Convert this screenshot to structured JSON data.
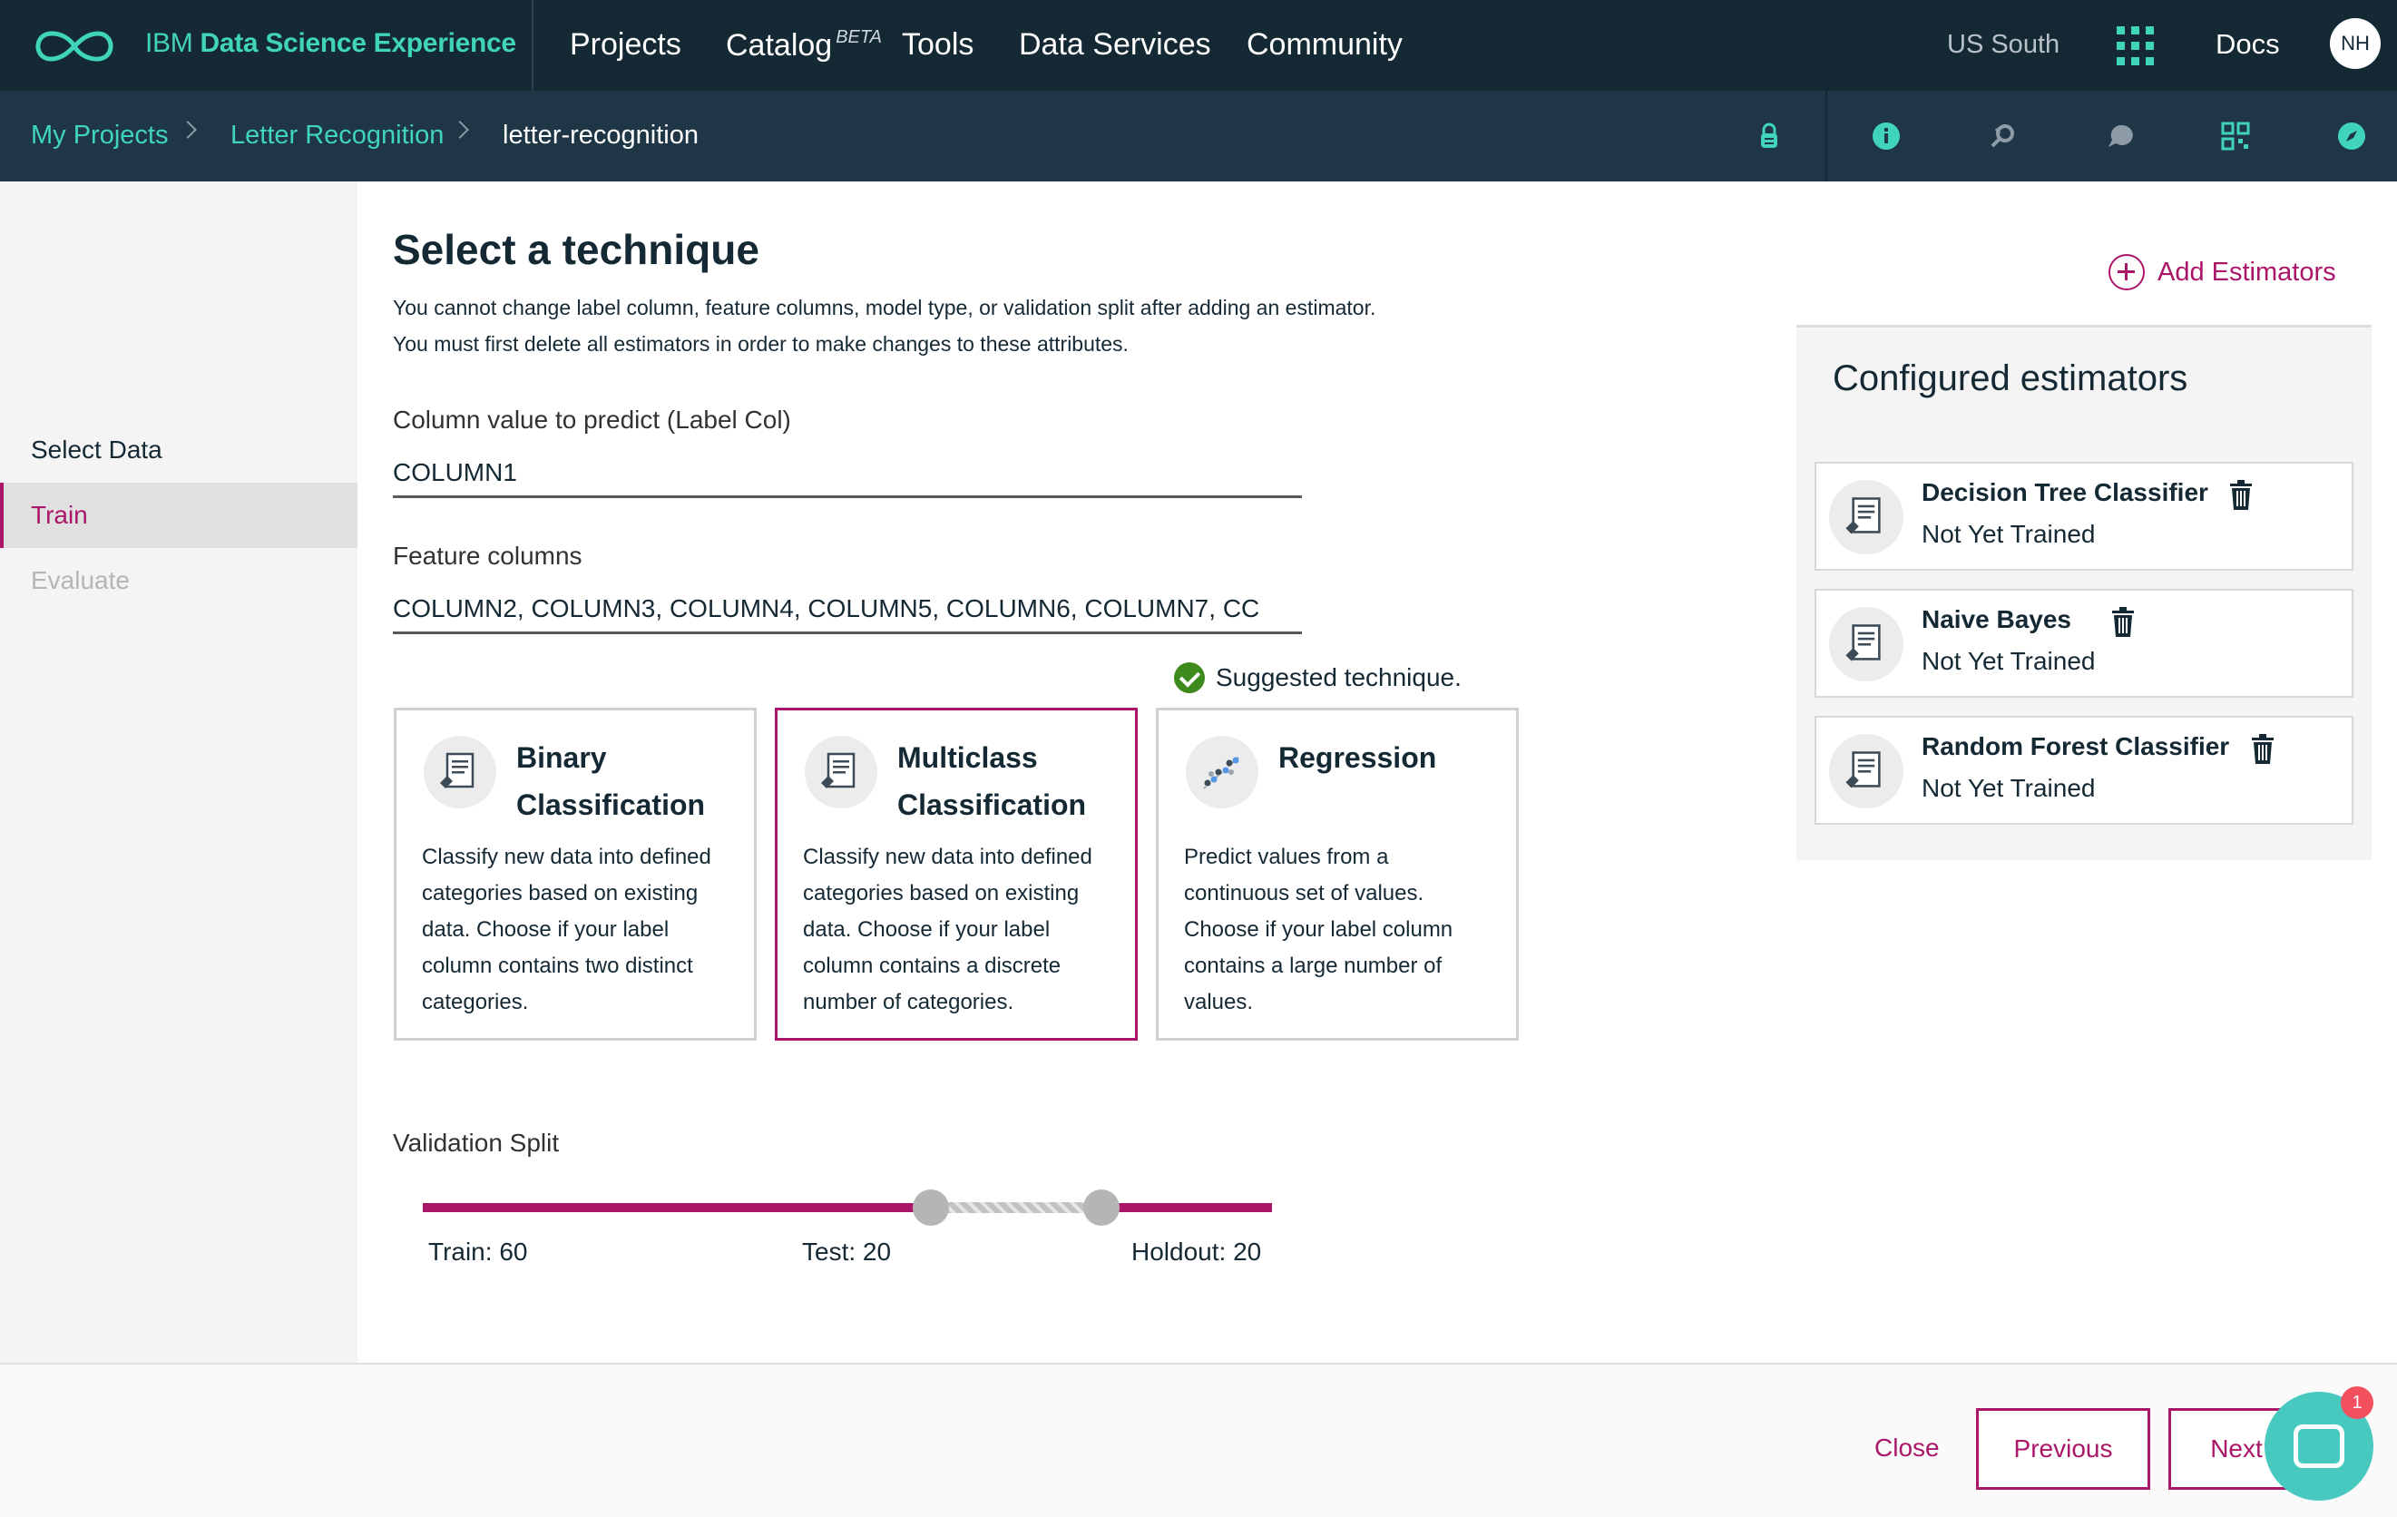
{
  "colors": {
    "topbar": "#152935",
    "subbar": "#1f3646",
    "accent_teal": "#40d5bb",
    "accent_magenta": "#aa1769",
    "chat": "#48c9c0",
    "badge": "#f34f5e",
    "check": "#3e8a1c"
  },
  "header": {
    "brand_prefix": "IBM",
    "brand_name": "Data Science Experience",
    "nav": [
      "Projects",
      "Catalog",
      "Tools",
      "Data Services",
      "Community"
    ],
    "catalog_badge": "BETA",
    "region": "US South",
    "apps_icon": "grid-icon",
    "docs": "Docs",
    "avatar_initials": "NH"
  },
  "breadcrumb": {
    "items": [
      "My Projects",
      "Letter Recognition",
      "letter-recognition"
    ]
  },
  "toolbar_icons": [
    "lock-icon",
    "info-icon",
    "find-replace-icon",
    "comment-icon",
    "qr-code-icon",
    "compass-icon"
  ],
  "sidebar": {
    "items": [
      {
        "label": "Select Data",
        "state": "normal"
      },
      {
        "label": "Train",
        "state": "active"
      },
      {
        "label": "Evaluate",
        "state": "disabled"
      }
    ]
  },
  "main": {
    "title": "Select a technique",
    "info_line1": "You cannot change label column, feature columns, model type, or validation split after adding an estimator.",
    "info_line2": "You must first delete all estimators in order to make changes to these attributes.",
    "label_col": {
      "label": "Column value to predict (Label Col)",
      "value": "COLUMN1"
    },
    "feature_cols": {
      "label": "Feature columns",
      "value": "COLUMN2, COLUMN3, COLUMN4, COLUMN5, COLUMN6, COLUMN7, CC"
    },
    "suggested": "Suggested technique.",
    "techniques": [
      {
        "title": "Binary Classification",
        "desc": "Classify new data into defined categories based on existing data. Choose if your label column contains two distinct categories.",
        "selected": false,
        "icon": "document-tag-icon"
      },
      {
        "title": "Multiclass Classification",
        "desc": "Classify new data into defined categories based on existing data. Choose if your label column contains a discrete number of categories.",
        "selected": true,
        "icon": "document-tag-icon"
      },
      {
        "title": "Regression",
        "desc": "Predict values from a continuous set of values. Choose if your label column contains a large number of values.",
        "selected": false,
        "icon": "scatter-plot-icon"
      }
    ],
    "validation": {
      "label": "Validation Split",
      "train": "Train: 60",
      "test": "Test: 20",
      "holdout": "Holdout: 20",
      "train_pct": 60,
      "test_pct": 20,
      "holdout_pct": 20
    }
  },
  "estimators": {
    "add_label": "Add Estimators",
    "heading": "Configured estimators",
    "items": [
      {
        "name": "Decision Tree Classifier",
        "status": "Not Yet Trained"
      },
      {
        "name": "Naive Bayes",
        "status": "Not Yet Trained"
      },
      {
        "name": "Random Forest Classifier",
        "status": "Not Yet Trained"
      }
    ]
  },
  "footer": {
    "close": "Close",
    "previous": "Previous",
    "next": "Next"
  },
  "chat": {
    "badge": "1"
  }
}
